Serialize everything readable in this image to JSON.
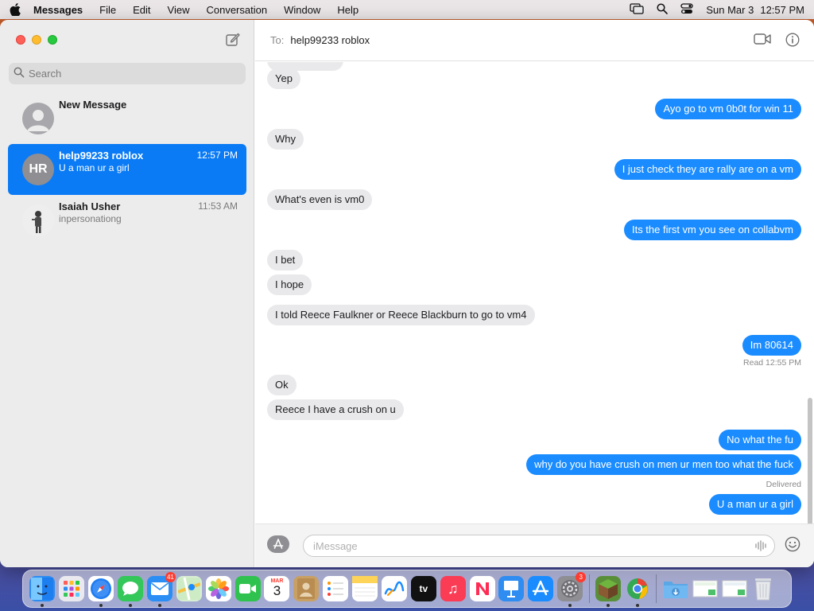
{
  "menubar": {
    "app_name": "Messages",
    "menus": [
      "File",
      "Edit",
      "View",
      "Conversation",
      "Window",
      "Help"
    ],
    "date": "Sun Mar 3",
    "time": "12:57 PM"
  },
  "sidebar": {
    "search_placeholder": "Search",
    "conversations": [
      {
        "name": "New Message",
        "preview": "",
        "time": "",
        "avatar": "person"
      },
      {
        "name": "help99233 roblox",
        "preview": "U a man ur a girl",
        "time": "12:57 PM",
        "initials": "HR",
        "selected": true
      },
      {
        "name": "Isaiah Usher",
        "preview": "inpersonationg",
        "time": "11:53 AM",
        "avatar": "photo"
      }
    ]
  },
  "header": {
    "to_label": "To:",
    "recipient": "help99233 roblox"
  },
  "messages": [
    {
      "from": "them",
      "text": "Yep"
    },
    {
      "from": "me",
      "text": "Ayo go to vm 0b0t for win 11"
    },
    {
      "from": "them",
      "text": "Why"
    },
    {
      "from": "me",
      "text": "I just check they are rally are on a vm"
    },
    {
      "from": "them",
      "text": "What's even is vm0"
    },
    {
      "from": "me",
      "text": "Its the first vm you see on collabvm"
    },
    {
      "from": "them",
      "text": "I bet"
    },
    {
      "from": "them",
      "text": "I hope"
    },
    {
      "from": "them",
      "text": "I told Reece Faulkner or Reece Blackburn to go to vm4"
    },
    {
      "from": "me",
      "text": "Im 80614"
    },
    {
      "from": "them",
      "text": "Ok"
    },
    {
      "from": "them",
      "text": "Reece I have a crush on u"
    },
    {
      "from": "me",
      "text": "No what the fu"
    },
    {
      "from": "me",
      "text": "why do you have crush   on men ur men too what the fuck"
    },
    {
      "from": "me",
      "text": "U a man ur a girl"
    }
  ],
  "receipts": {
    "read": "Read 12:55 PM",
    "delivered": "Delivered"
  },
  "composer": {
    "placeholder": "iMessage"
  },
  "dock": {
    "apps": [
      {
        "name": "finder-icon",
        "color": "#2d8cf0",
        "glyph": "☺"
      },
      {
        "name": "launchpad-icon",
        "color": "#e8e8ee",
        "glyph": ""
      },
      {
        "name": "safari-icon",
        "color": "#1e7cf2",
        "glyph": "⊘"
      },
      {
        "name": "messages-icon",
        "color": "#34c759",
        "glyph": ""
      },
      {
        "name": "mail-icon",
        "color": "#2a8ef5",
        "glyph": "✉",
        "badge": "41"
      },
      {
        "name": "maps-icon",
        "color": "#4fbf5a",
        "glyph": ""
      },
      {
        "name": "photos-icon",
        "color": "#ffffff",
        "glyph": ""
      },
      {
        "name": "facetime-icon",
        "color": "#30c24e",
        "glyph": ""
      },
      {
        "name": "calendar-icon",
        "color": "#ffffff",
        "month": "MAR",
        "day": "3"
      },
      {
        "name": "contacts-icon",
        "color": "#c9a064",
        "glyph": ""
      },
      {
        "name": "reminders-icon",
        "color": "#ffffff",
        "glyph": ""
      },
      {
        "name": "notes-icon",
        "color": "#fde58a",
        "glyph": ""
      },
      {
        "name": "freeform-icon",
        "color": "#ffffff",
        "glyph": ""
      },
      {
        "name": "appletv-icon",
        "color": "#111111",
        "glyph": "tv"
      },
      {
        "name": "music-icon",
        "color": "#fa3c55",
        "glyph": "♫"
      },
      {
        "name": "news-icon",
        "color": "#ffffff",
        "glyph": "N"
      },
      {
        "name": "keynote-icon",
        "color": "#2f8cf0",
        "glyph": ""
      },
      {
        "name": "appstore-icon",
        "color": "#1a8cff",
        "glyph": "A"
      },
      {
        "name": "system-settings-icon",
        "color": "#8e8e93",
        "glyph": "⚙",
        "badge": "3"
      },
      {
        "name": "minecraft-icon",
        "color": "#5a8f3a",
        "glyph": ""
      },
      {
        "name": "chrome-icon",
        "color": "#ffffff",
        "glyph": ""
      },
      {
        "name": "downloads-folder-icon",
        "color": "#6fb3ee",
        "glyph": ""
      },
      {
        "name": "screenshot-file-icon",
        "color": "#f2f2f2",
        "glyph": ""
      },
      {
        "name": "screenshot-file-2-icon",
        "color": "#f2f2f2",
        "glyph": ""
      },
      {
        "name": "trash-icon",
        "color": "#d7dadf",
        "glyph": ""
      }
    ]
  }
}
